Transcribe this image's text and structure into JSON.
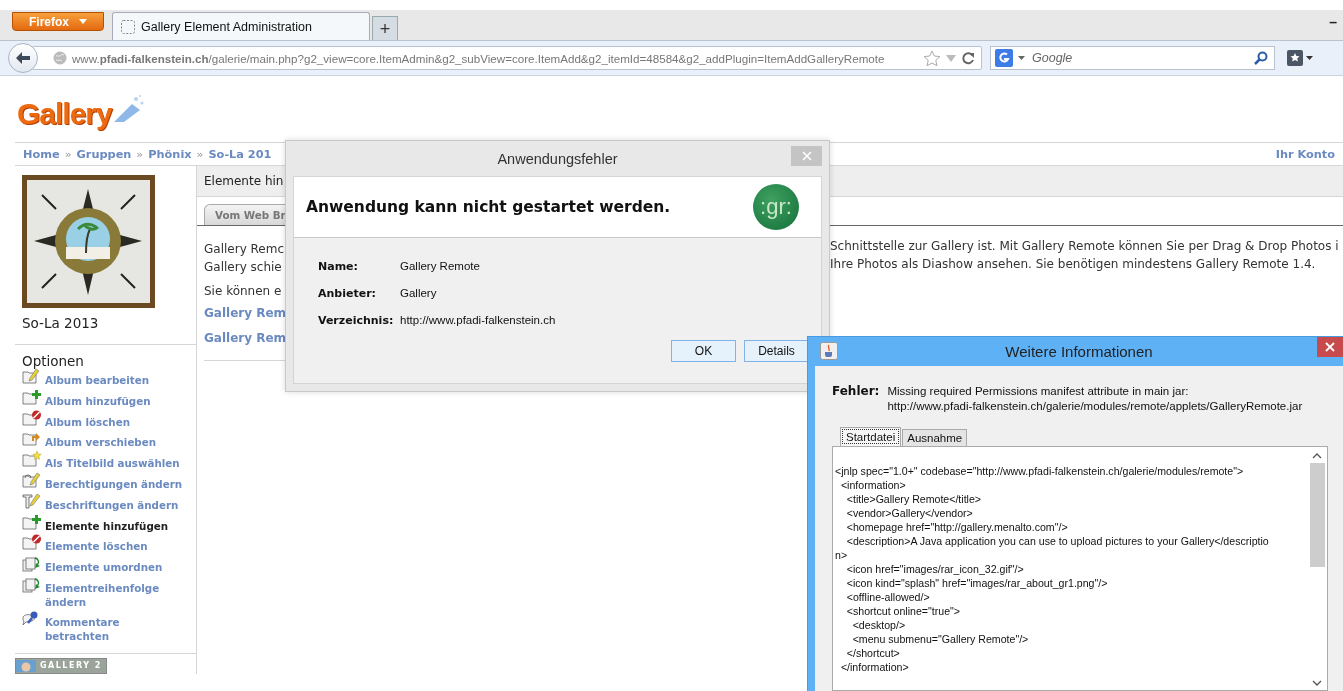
{
  "browser": {
    "menu_button": "Firefox",
    "tabs": [
      {
        "title": "Gallery Element Administration",
        "selected": true
      }
    ],
    "new_tab": "+",
    "minimize": "–",
    "address": "www.**pfadi-falkenstein.ch**/galerie/main.php?g2_view=core.ItemAdmin&g2_subView=core.ItemAdd&g2_itemId=48584&g2_addPlugin=ItemAddGalleryRemote",
    "search": {
      "placeholder": "Google"
    }
  },
  "page": {
    "logo": "Gallery",
    "breadcrumb": [
      {
        "kind": "link",
        "text": "Home"
      },
      {
        "kind": "sep",
        "text": "»"
      },
      {
        "kind": "link",
        "text": "Gruppen"
      },
      {
        "kind": "sep",
        "text": "»"
      },
      {
        "kind": "link",
        "text": "Phönix"
      },
      {
        "kind": "sep",
        "text": "»"
      },
      {
        "kind": "link",
        "text": "So-La 201"
      }
    ],
    "account_link": "Ihr Konto",
    "album": {
      "title": "So-La 2013"
    },
    "options_heading": "Optionen",
    "options": [
      {
        "kind": "edit",
        "label": "Album bearbeiten",
        "selected": false
      },
      {
        "kind": "add",
        "label": "Album hinzufügen",
        "selected": false
      },
      {
        "kind": "delete",
        "label": "Album löschen",
        "selected": false
      },
      {
        "kind": "move",
        "label": "Album verschieben",
        "selected": false
      },
      {
        "kind": "star",
        "label": "Als Titelbild auswählen",
        "selected": false
      },
      {
        "kind": "permissions",
        "label": "Berechtigungen ändern",
        "selected": false
      },
      {
        "kind": "captions",
        "label": "Beschriftungen ändern",
        "selected": false
      },
      {
        "kind": "add",
        "label": "Elemente hinzufügen",
        "selected": true
      },
      {
        "kind": "delete",
        "label": "Elemente löschen",
        "selected": false
      },
      {
        "kind": "reorder",
        "label": "Elemente umordnen",
        "selected": false
      },
      {
        "kind": "reorder",
        "label": "Elementreihenfolge\nändern",
        "selected": false
      },
      {
        "kind": "comments",
        "label": "Kommentare\nbetrachten",
        "selected": false
      }
    ],
    "badge": "GALLERY 2",
    "main": {
      "section_title": "Elemente hin",
      "tabs": [
        {
          "label": "Vom Web Br",
          "selected": true
        }
      ],
      "left_texts": [
        {
          "kind": "text",
          "text": "Gallery Remc"
        },
        {
          "kind": "text",
          "text": "Gallery schie"
        },
        {
          "kind": "gap",
          "text": "Sie können e"
        },
        {
          "kind": "link",
          "text": "Gallery Rem"
        },
        {
          "kind": "link",
          "text": "Gallery Rem"
        }
      ],
      "right_texts": [
        "Schnittstelle zur Gallery ist. Mit Gallery Remote können Sie per Drag & Drop Photos i",
        "Ihre Photos als Diashow ansehen. Sie benötigen mindestens Gallery Remote 1.4."
      ]
    }
  },
  "error_dialog": {
    "title": "Anwendungsfehler",
    "heading": "Anwendung kann nicht gestartet werden.",
    "app_icon_text": ":gr:",
    "fields": [
      {
        "label": "Name:",
        "value": "Gallery Remote"
      },
      {
        "label": "Anbieter:",
        "value": "Gallery"
      },
      {
        "label": "Verzeichnis:",
        "value": "http://www.pfadi-falkenstein.ch"
      }
    ],
    "buttons": [
      "OK",
      "Details"
    ]
  },
  "info_dialog": {
    "title": "Weitere Informationen",
    "error_label": "Fehler:",
    "error_lines": [
      "Missing required Permissions manifest attribute in main jar:",
      "http://www.pfadi-falkenstein.ch/galerie/modules/remote/applets/GalleryRemote.jar"
    ],
    "tabs": [
      {
        "label": "Startdatei",
        "selected": true
      },
      {
        "label": "Ausnahme",
        "selected": false
      }
    ],
    "code_lines": [
      "<jnlp spec=\"1.0+\" codebase=\"http://www.pfadi-falkenstein.ch/galerie/modules/remote\">",
      "  <information>",
      "    <title>Gallery Remote</title>",
      "    <vendor>Gallery</vendor>",
      "    <homepage href=\"http://gallery.menalto.com\"/>",
      "    <description>A Java application you can use to upload pictures to your Gallery</descriptio",
      "n>",
      "    <icon href=\"images/rar_icon_32.gif\"/>",
      "    <icon kind=\"splash\" href=\"images/rar_about_gr1.png\"/>",
      "    <offline-allowed/>",
      "    <shortcut online=\"true\">",
      "      <desktop/>",
      "      <menu submenu=\"Gallery Remote\"/>",
      "    </shortcut>",
      "  </information>"
    ]
  }
}
